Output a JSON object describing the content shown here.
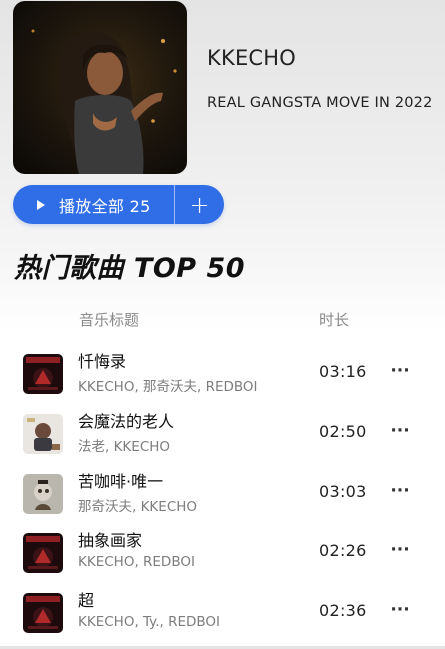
{
  "header": {
    "cover_icon": "album-cover-photo",
    "artist": "KKECHO",
    "album_title": "REAL GANGSTA MOVE IN 2022"
  },
  "actions": {
    "play_all_label": "播放全部 25",
    "play_icon": "play-icon",
    "add_label": "+",
    "accent_color": "#2f6ee6"
  },
  "section": {
    "title": "热门歌曲 TOP 50",
    "col_title": "音乐标题",
    "col_duration": "时长"
  },
  "tracks": [
    {
      "title": "忏悔录",
      "artists": "KKECHO, 那奇沃夫, REDBOI",
      "duration": "03:16",
      "more": "···"
    },
    {
      "title": "会魔法的老人",
      "artists": "法老, KKECHO",
      "duration": "02:50",
      "more": "···"
    },
    {
      "title": "苦咖啡·唯一",
      "artists": "那奇沃夫, KKECHO",
      "duration": "03:03",
      "more": "···"
    },
    {
      "title": "抽象画家",
      "artists": "KKECHO, REDBOI",
      "duration": "02:26",
      "more": "···"
    },
    {
      "title": "超",
      "artists": "KKECHO, Ty., REDBOI",
      "duration": "02:36",
      "more": "···"
    }
  ]
}
